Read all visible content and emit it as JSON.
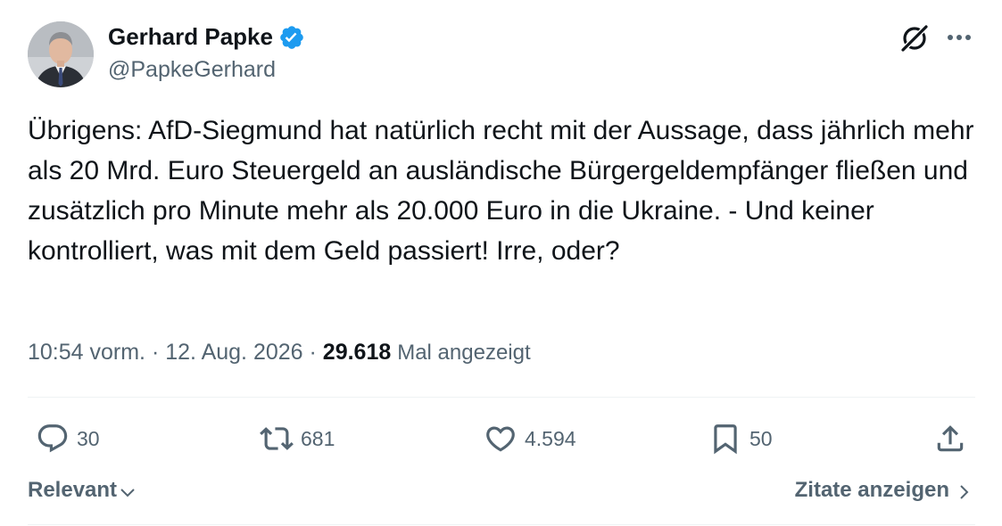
{
  "author": {
    "name": "Gerhard Papke",
    "handle": "@PapkeGerhard",
    "verified": true
  },
  "tweet": {
    "text": "Übrigens: AfD-Siegmund hat natürlich recht mit der Aussage, dass jährlich mehr als 20 Mrd. Euro Steuergeld an ausländische Bürgergeldempfänger fließen und zusätzlich pro Minute mehr als 20.000 Euro in die Ukraine. - Und keiner kontrolliert, was mit dem Geld passiert! Irre, oder?",
    "time": "10:54 vorm.",
    "separator": "·",
    "date": "12. Aug. 2026",
    "views_count": "29.618",
    "views_label": "Mal angezeigt"
  },
  "actions": {
    "replies": "30",
    "reposts": "681",
    "likes": "4.594",
    "bookmarks": "50"
  },
  "footer": {
    "sort_label": "Relevant",
    "quotes_label": "Zitate anzeigen"
  },
  "colors": {
    "text_primary": "#0f1419",
    "text_secondary": "#536471",
    "verified_blue": "#1d9bf0",
    "divider": "#eff3f4"
  },
  "icons": [
    "grok-icon",
    "more-icon",
    "verified-badge-icon",
    "reply-icon",
    "repost-icon",
    "like-icon",
    "bookmark-icon",
    "share-icon",
    "chevron-down-icon",
    "chevron-right-icon"
  ]
}
